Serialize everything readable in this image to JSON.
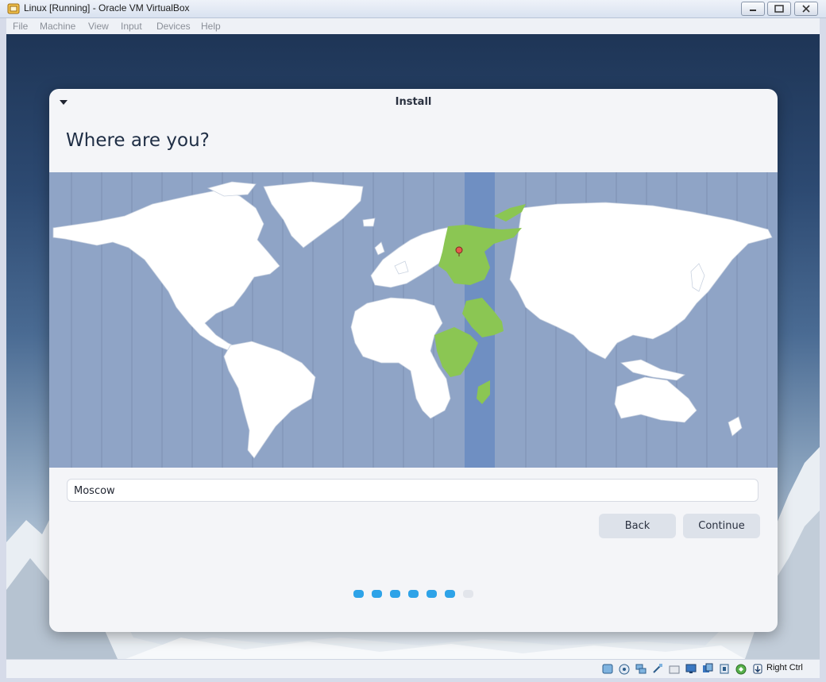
{
  "window": {
    "title": "Linux [Running] - Oracle VM VirtualBox"
  },
  "menubar": {
    "items": [
      "File",
      "Machine",
      "View",
      "Input",
      "Devices",
      "Help"
    ]
  },
  "installer": {
    "title": "Install",
    "heading": "Where are you?",
    "timezone_value": "Moscow",
    "back_label": "Back",
    "continue_label": "Continue",
    "progress": {
      "total_steps": 7,
      "current_step": 6
    },
    "selected_zone_color": "#8bc653",
    "highlight_band_color": "#6f8fc2",
    "accent_color": "#2ea3e8"
  },
  "statusbar": {
    "host_key": "Right Ctrl",
    "icons": [
      "hard-disk-icon",
      "optical-drive-icon",
      "network-icon",
      "usb-icon",
      "shared-folders-icon",
      "display-icon",
      "recording-icon",
      "cpu-icon",
      "guest-additions-icon",
      "mouse-integration-icon"
    ]
  }
}
